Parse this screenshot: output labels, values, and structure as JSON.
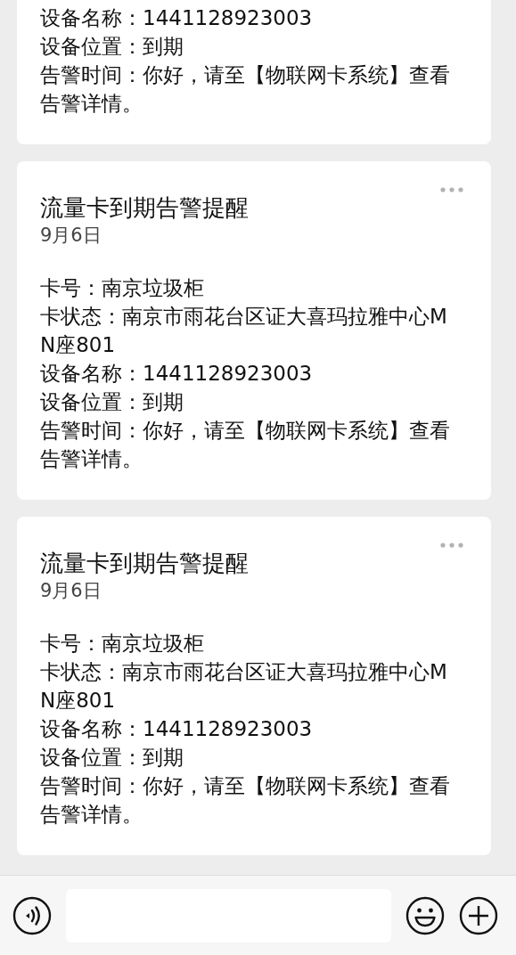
{
  "messages": [
    {
      "cut_top": true,
      "lines": [
        "设备名称：1441128923003",
        "设备位置：到期",
        "告警时间：你好，请至【物联网卡系统】查看告警详情。"
      ]
    },
    {
      "cut_top": false,
      "title": "流量卡到期告警提醒",
      "date": "9月6日",
      "lines": [
        "卡号：南京垃圾柜",
        "卡状态：南京市雨花台区证大喜玛拉雅中心MN座801",
        "设备名称：1441128923003",
        "设备位置：到期",
        "告警时间：你好，请至【物联网卡系统】查看告警详情。"
      ]
    },
    {
      "cut_top": false,
      "title": "流量卡到期告警提醒",
      "date": "9月6日",
      "lines": [
        "卡号：南京垃圾柜",
        "卡状态：南京市雨花台区证大喜玛拉雅中心MN座801",
        "设备名称：1441128923003",
        "设备位置：到期",
        "告警时间：你好，请至【物联网卡系统】查看告警详情。"
      ]
    }
  ],
  "input_bar": {
    "buttons": [
      {
        "kind": "voice"
      },
      {
        "kind": "field"
      },
      {
        "kind": "emoji"
      },
      {
        "kind": "plus"
      }
    ]
  }
}
